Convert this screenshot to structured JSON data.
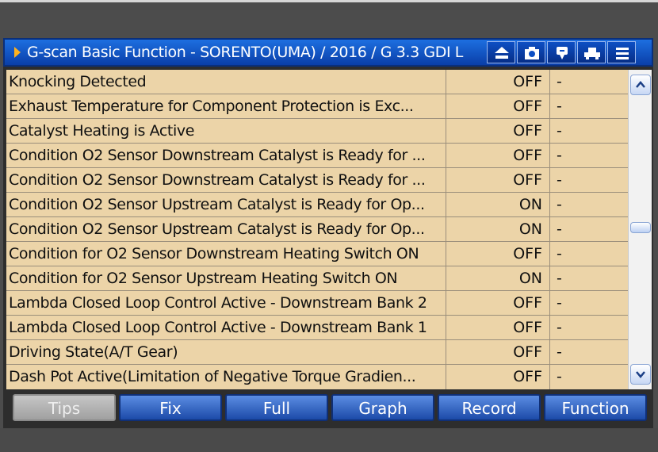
{
  "window": {
    "title": "G-scan Basic Function - SORENTO(UMA) / 2016 / G 3.3 GDI L",
    "toolbar_icons": [
      "home-icon",
      "camera-icon",
      "help-icon",
      "vehicle-icon",
      "menu-icon"
    ]
  },
  "rows": [
    {
      "name": "Knocking Detected",
      "value": "OFF",
      "unit": "-"
    },
    {
      "name": "Exhaust Temperature for Component Protection is Exc...",
      "value": "OFF",
      "unit": "-"
    },
    {
      "name": "Catalyst Heating is Active",
      "value": "OFF",
      "unit": "-"
    },
    {
      "name": "Condition O2 Sensor Downstream Catalyst is Ready for ...",
      "value": "OFF",
      "unit": "-"
    },
    {
      "name": "Condition O2 Sensor Downstream Catalyst is Ready for ...",
      "value": "OFF",
      "unit": "-"
    },
    {
      "name": "Condition O2 Sensor Upstream Catalyst is Ready for Op...",
      "value": "ON",
      "unit": "-"
    },
    {
      "name": "Condition O2 Sensor Upstream Catalyst is Ready for Op...",
      "value": "ON",
      "unit": "-"
    },
    {
      "name": "Condition for O2 Sensor Downstream Heating Switch ON",
      "value": "OFF",
      "unit": "-"
    },
    {
      "name": "Condition for O2 Sensor Upstream Heating Switch ON",
      "value": "ON",
      "unit": "-"
    },
    {
      "name": "Lambda Closed Loop Control Active - Downstream Bank 2",
      "value": "OFF",
      "unit": "-"
    },
    {
      "name": "Lambda Closed Loop Control Active - Downstream Bank 1",
      "value": "OFF",
      "unit": "-"
    },
    {
      "name": "Driving State(A/T Gear)",
      "value": "OFF",
      "unit": "-"
    },
    {
      "name": "Dash Pot Active(Limitation of Negative Torque Gradien...",
      "value": "OFF",
      "unit": "-"
    }
  ],
  "buttons": {
    "tips": "Tips",
    "fix": "Fix",
    "full": "Full",
    "graph": "Graph",
    "record": "Record",
    "function": "Function"
  },
  "colors": {
    "title_bar": "#0a3ea8",
    "table_bg": "#ecd4a8",
    "button_blue": "#1c4aa8",
    "button_disabled": "#a0a0a0",
    "title_arrow": "#ffb21e"
  }
}
